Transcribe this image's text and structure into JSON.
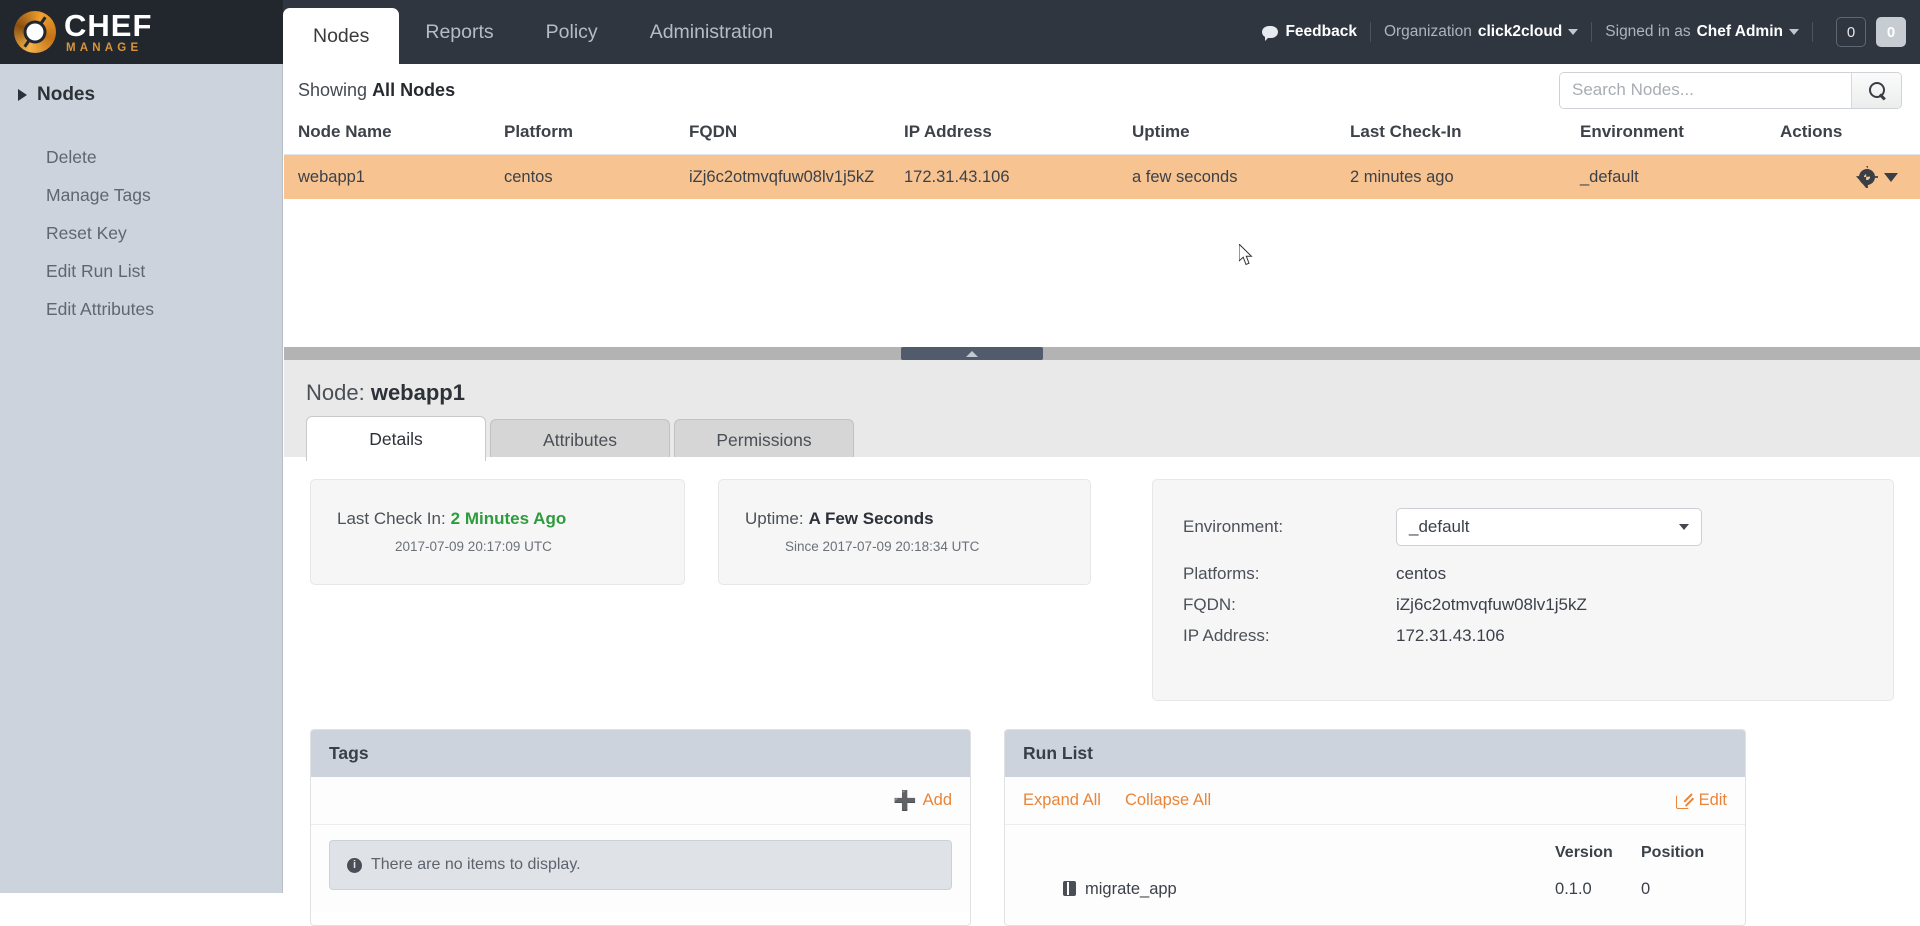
{
  "brand": {
    "name": "CHEF",
    "sub": "MANAGE",
    "logo_icon": "chef-logo-icon"
  },
  "topnav": {
    "tabs": [
      {
        "label": "Nodes",
        "active": true
      },
      {
        "label": "Reports",
        "active": false
      },
      {
        "label": "Policy",
        "active": false
      },
      {
        "label": "Administration",
        "active": false
      }
    ],
    "feedback_label": "Feedback",
    "feedback_icon": "speech-bubble-icon",
    "organization_label": "Organization",
    "organization_value": "click2cloud",
    "signed_in_label": "Signed in as",
    "signed_in_user": "Chef Admin",
    "badge_outline_count": "0",
    "badge_filled_count": "0"
  },
  "sidebar": {
    "header": "Nodes",
    "header_icon": "chevron-right-icon",
    "items": [
      {
        "label": "Delete"
      },
      {
        "label": "Manage Tags"
      },
      {
        "label": "Reset Key"
      },
      {
        "label": "Edit Run List"
      },
      {
        "label": "Edit Attributes"
      }
    ]
  },
  "content": {
    "showing_prefix": "Showing ",
    "showing_value": "All Nodes",
    "search": {
      "placeholder": "Search Nodes...",
      "value": "",
      "icon": "search-icon"
    }
  },
  "nodes_table": {
    "columns": [
      "Node Name",
      "Platform",
      "FQDN",
      "IP Address",
      "Uptime",
      "Last Check-In",
      "Environment",
      "Actions"
    ],
    "rows": [
      {
        "node_name": "webapp1",
        "platform": "centos",
        "fqdn": "iZj6c2otmvqfuw08lv1j5kZ",
        "ip_address": "172.31.43.106",
        "uptime": "a few seconds",
        "last_check_in": "2 minutes ago",
        "environment": "_default",
        "actions_icon": "gear-icon",
        "selected": true
      }
    ]
  },
  "splitter": {
    "icon": "collapse-up-arrow-icon"
  },
  "detail": {
    "title_prefix": "Node: ",
    "title_value": "webapp1",
    "tabs": [
      {
        "label": "Details",
        "active": true
      },
      {
        "label": "Attributes",
        "active": false
      },
      {
        "label": "Permissions",
        "active": false
      }
    ],
    "last_check_in": {
      "label": "Last Check In:",
      "value": "2 Minutes Ago",
      "timestamp": "2017-07-09 20:17:09 UTC",
      "value_color": "#2e9b3e"
    },
    "uptime": {
      "label": "Uptime:",
      "value": "A Few Seconds",
      "timestamp": "Since 2017-07-09 20:18:34 UTC"
    },
    "info": {
      "environment_label": "Environment:",
      "environment_value": "_default",
      "platforms_label": "Platforms:",
      "platforms_value": "centos",
      "fqdn_label": "FQDN:",
      "fqdn_value": "iZj6c2otmvqfuw08lv1j5kZ",
      "ip_label": "IP Address:",
      "ip_value": "172.31.43.106"
    },
    "tags_panel": {
      "title": "Tags",
      "add_label": "Add",
      "add_icon": "plus-icon",
      "empty_message": "There are no items to display.",
      "empty_icon": "info-icon"
    },
    "runlist_panel": {
      "title": "Run List",
      "expand_all_label": "Expand All",
      "collapse_all_label": "Collapse All",
      "edit_label": "Edit",
      "edit_icon": "edit-pencil-icon",
      "columns": {
        "name": "",
        "version": "Version",
        "position": "Position"
      },
      "items": [
        {
          "name": "migrate_app",
          "version": "0.1.0",
          "position": "0",
          "icon": "cookbook-icon"
        }
      ]
    }
  },
  "colors": {
    "topbar_bg": "#2f3640",
    "logo_bg": "#22272e",
    "sidebar_bg": "#ccd3dd",
    "row_selected_bg": "#f7c391",
    "accent_orange": "#e8853a",
    "success_green": "#2e9b3e",
    "panel_head_bg": "#ccd3dd"
  }
}
